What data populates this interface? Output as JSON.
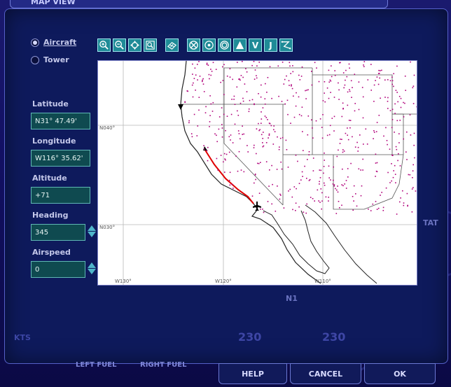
{
  "window": {
    "title": "MAP VIEW"
  },
  "mode": {
    "options": [
      {
        "label": "Aircraft",
        "selected": true
      },
      {
        "label": "Tower",
        "selected": false
      }
    ]
  },
  "fields": {
    "latitude": {
      "label": "Latitude",
      "value": "N31° 47.49'"
    },
    "longitude": {
      "label": "Longitude",
      "value": "W116° 35.62'"
    },
    "altitude": {
      "label": "Altitude",
      "value": "+71"
    },
    "heading": {
      "label": "Heading",
      "value": "345"
    },
    "airspeed": {
      "label": "Airspeed",
      "value": "0"
    }
  },
  "toolbar": {
    "icons": [
      "zoom-in-icon",
      "zoom-out-icon",
      "center-icon",
      "zoom-box-icon",
      "route-icon",
      "vor-icon",
      "ndb-icon",
      "airport-icon",
      "triangle-icon",
      "v-airway-icon",
      "j-airway-icon",
      "flightplan-icon"
    ],
    "labels": {
      "v": "V",
      "j": "J"
    }
  },
  "map": {
    "grid_labels": {
      "n40": "N040°",
      "n30": "N030°",
      "w130": "W130°",
      "w120": "W120°",
      "w110": "W110°"
    }
  },
  "background": {
    "left_fuel": "LEFT FUEL",
    "right_fuel": "RIGHT FUEL",
    "kts": "KTS",
    "n1": "N1",
    "tat": "TAT",
    "gauge1": "230",
    "gauge2": "230"
  },
  "buttons": {
    "help": "HELP",
    "cancel": "CANCEL",
    "ok": "OK"
  },
  "colors": {
    "accent": "#1f8b97",
    "field": "#0f4a50",
    "panel": "#0e1a5c",
    "route": "#e00000"
  }
}
